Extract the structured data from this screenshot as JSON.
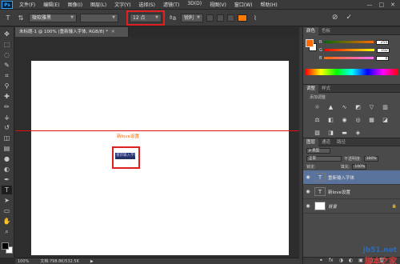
{
  "app": {
    "logo": "Ps"
  },
  "menubar": {
    "items": [
      "文件(F)",
      "编辑(E)",
      "图像(I)",
      "图层(L)",
      "文字(Y)",
      "选择(S)",
      "滤镜(T)",
      "3D(D)",
      "视图(V)",
      "窗口(W)",
      "帮助(H)"
    ],
    "window_controls": [
      "—",
      "□",
      "✕"
    ]
  },
  "options_bar": {
    "tool_icon": "type-tool-icon",
    "orientation_icon": "text-orientation-icon",
    "font_family": "微软雅黑",
    "font_style": "",
    "font_size": "12 点",
    "antialias_icon": "aa-icon",
    "antialias": "锐利",
    "text_color": "#ff7a00",
    "cancel_icon": "cancel-icon",
    "commit_icon": "commit-check-icon"
  },
  "tools": [
    {
      "name": "move-tool-icon",
      "glyph": "✥"
    },
    {
      "name": "marquee-tool-icon",
      "glyph": "⬚"
    },
    {
      "name": "lasso-tool-icon",
      "glyph": "◌"
    },
    {
      "name": "quick-select-tool-icon",
      "glyph": "✎"
    },
    {
      "name": "crop-tool-icon",
      "glyph": "⌗"
    },
    {
      "name": "eyedropper-tool-icon",
      "glyph": "⚲"
    },
    {
      "name": "healing-brush-tool-icon",
      "glyph": "✚"
    },
    {
      "name": "brush-tool-icon",
      "glyph": "✏"
    },
    {
      "name": "clone-stamp-tool-icon",
      "glyph": "⚶"
    },
    {
      "name": "history-brush-tool-icon",
      "glyph": "↺"
    },
    {
      "name": "eraser-tool-icon",
      "glyph": "◫"
    },
    {
      "name": "gradient-tool-icon",
      "glyph": "▤"
    },
    {
      "name": "blur-tool-icon",
      "glyph": "●"
    },
    {
      "name": "dodge-tool-icon",
      "glyph": "◐"
    },
    {
      "name": "pen-tool-icon",
      "glyph": "✒"
    },
    {
      "name": "type-tool-icon",
      "glyph": "T",
      "active": true
    },
    {
      "name": "path-select-tool-icon",
      "glyph": "➤"
    },
    {
      "name": "shape-tool-icon",
      "glyph": "▭"
    },
    {
      "name": "hand-tool-icon",
      "glyph": "✋"
    },
    {
      "name": "zoom-tool-icon",
      "glyph": "⌕"
    }
  ],
  "document": {
    "tab_title": "未标题-1 @ 100% (重新输入字体, RGB/8) *",
    "close": "✕",
    "small_text": "新love设置",
    "selected_text": "重新输入字体",
    "guide_color": "#e01010",
    "highlight_color": "#e02020"
  },
  "statusbar": {
    "zoom": "100%",
    "doc_info": "文档:798.8K/532.5K",
    "arrow": "▶"
  },
  "color_panel": {
    "tabs": [
      "颜色",
      "色板"
    ],
    "fg_color": "#ff6a00",
    "bg_color": "#ffffff",
    "sliders": [
      {
        "label": "R",
        "value": "255",
        "gradient": "linear-gradient(to right,#006a00,#ff6a00)"
      },
      {
        "label": "G",
        "value": "102",
        "gradient": "linear-gradient(to right,#ff0000,#ffff00)"
      },
      {
        "label": "B",
        "value": "0",
        "gradient": "linear-gradient(to right,#ff6a00,#ff6aff)"
      }
    ]
  },
  "adjustments_panel": {
    "tabs": [
      "调整",
      "样式"
    ],
    "subtitle": "添加调整",
    "icons": [
      {
        "name": "brightness-icon",
        "glyph": "☼"
      },
      {
        "name": "levels-icon",
        "glyph": "▲"
      },
      {
        "name": "curves-icon",
        "glyph": "∿"
      },
      {
        "name": "exposure-icon",
        "glyph": "◩"
      },
      {
        "name": "vibrance-icon",
        "glyph": "▽"
      },
      {
        "name": "hue-sat-icon",
        "glyph": "▥"
      },
      {
        "name": "color-balance-icon",
        "glyph": "⚖"
      },
      {
        "name": "black-white-icon",
        "glyph": "◧"
      },
      {
        "name": "photo-filter-icon",
        "glyph": "◉"
      },
      {
        "name": "channel-mixer-icon",
        "glyph": "◎"
      },
      {
        "name": "color-lookup-icon",
        "glyph": "▦"
      },
      {
        "name": "invert-icon",
        "glyph": "◪"
      },
      {
        "name": "posterize-icon",
        "glyph": "▧"
      },
      {
        "name": "threshold-icon",
        "glyph": "◨"
      },
      {
        "name": "gradient-map-icon",
        "glyph": "▬"
      },
      {
        "name": "selective-color-icon",
        "glyph": "◈"
      }
    ]
  },
  "layers_panel": {
    "tabs": [
      "图层",
      "通道",
      "路径"
    ],
    "kind_label": "ρ 类型",
    "blend_mode": "正常",
    "opacity_label": "不透明度:",
    "opacity": "100%",
    "lock_label": "锁定:",
    "fill_label": "填充:",
    "fill": "100%",
    "layers": [
      {
        "name": "重新输入字体",
        "thumb": "T",
        "active": true,
        "white": false,
        "italic": false
      },
      {
        "name": "新love设置",
        "thumb": "T",
        "active": false,
        "white": false,
        "italic": false
      },
      {
        "name": "背景",
        "thumb": "",
        "active": false,
        "white": true,
        "italic": true,
        "locked": true
      }
    ],
    "footer_icons": [
      "⚭",
      "fx",
      "◑",
      "◐",
      "▣",
      "▢",
      "🗑"
    ]
  },
  "watermark": {
    "url": "jb51.net",
    "text": "脚本之家"
  }
}
